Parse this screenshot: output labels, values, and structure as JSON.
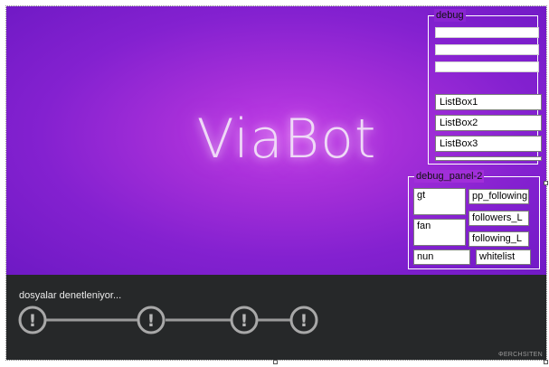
{
  "splash": {
    "logo_text": "ViaBot"
  },
  "debug_group": {
    "label": "debug",
    "textboxes": [
      "",
      "",
      ""
    ],
    "listboxes": [
      "ListBox1",
      "ListBox2",
      "ListBox3"
    ]
  },
  "debug_panel_2": {
    "label": "debug_panel-2",
    "gt": "gt",
    "fan": "fan",
    "nun": "nun",
    "pp_following": "pp_following",
    "followers_l": "followers_L",
    "following_l": "following_L",
    "whitelist": "whitelist"
  },
  "status": {
    "text": "dosyalar denetleniyor...",
    "steps": [
      {
        "icon": "warning-icon",
        "glyph": "!"
      },
      {
        "icon": "warning-icon",
        "glyph": "!"
      },
      {
        "icon": "warning-icon",
        "glyph": "!"
      },
      {
        "icon": "warning-icon",
        "glyph": "!"
      }
    ]
  },
  "watermark": "ΦERCHSITEN"
}
